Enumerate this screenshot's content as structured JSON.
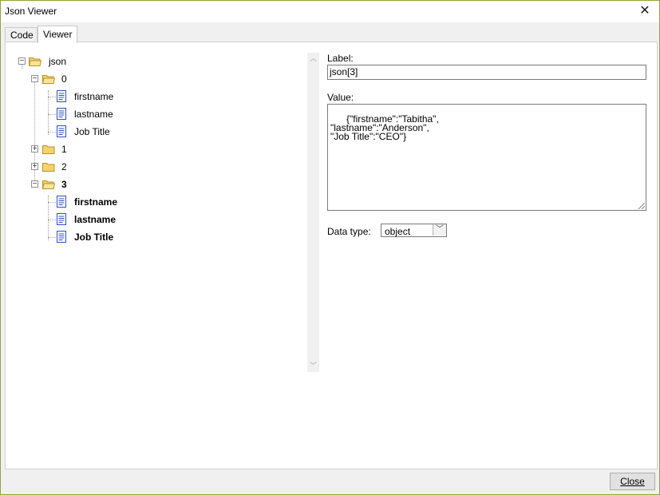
{
  "window": {
    "title": "Json Viewer"
  },
  "tabs": [
    {
      "label": "Code",
      "active": false
    },
    {
      "label": "Viewer",
      "active": true
    }
  ],
  "tree": {
    "root": "json",
    "nodes": [
      {
        "label": "0",
        "type": "folder",
        "expanded": true
      },
      {
        "label": "firstname",
        "type": "doc"
      },
      {
        "label": "lastname",
        "type": "doc"
      },
      {
        "label": "Job Title",
        "type": "doc"
      },
      {
        "label": "1",
        "type": "folder",
        "expanded": false
      },
      {
        "label": "2",
        "type": "folder",
        "expanded": false
      },
      {
        "label": "3",
        "type": "folder",
        "expanded": true,
        "selected": true
      },
      {
        "label": "firstname",
        "type": "doc",
        "bold": true
      },
      {
        "label": "lastname",
        "type": "doc",
        "bold": true
      },
      {
        "label": "Job Title",
        "type": "doc",
        "bold": true
      }
    ]
  },
  "details": {
    "label_caption": "Label:",
    "label_value": "json[3]",
    "value_caption": "Value:",
    "value_text": "{\"firstname\":\"Tabitha\",\n\"lastname\":\"Anderson\",\n\"Job Title\":\"CEO\"}",
    "datatype_caption": "Data type:",
    "datatype_value": "object"
  },
  "footer": {
    "close_label": "Close"
  },
  "colors": {
    "window_border": "#8fa33e",
    "folder": "#f5d26a",
    "doc": "#2b4fc7"
  }
}
